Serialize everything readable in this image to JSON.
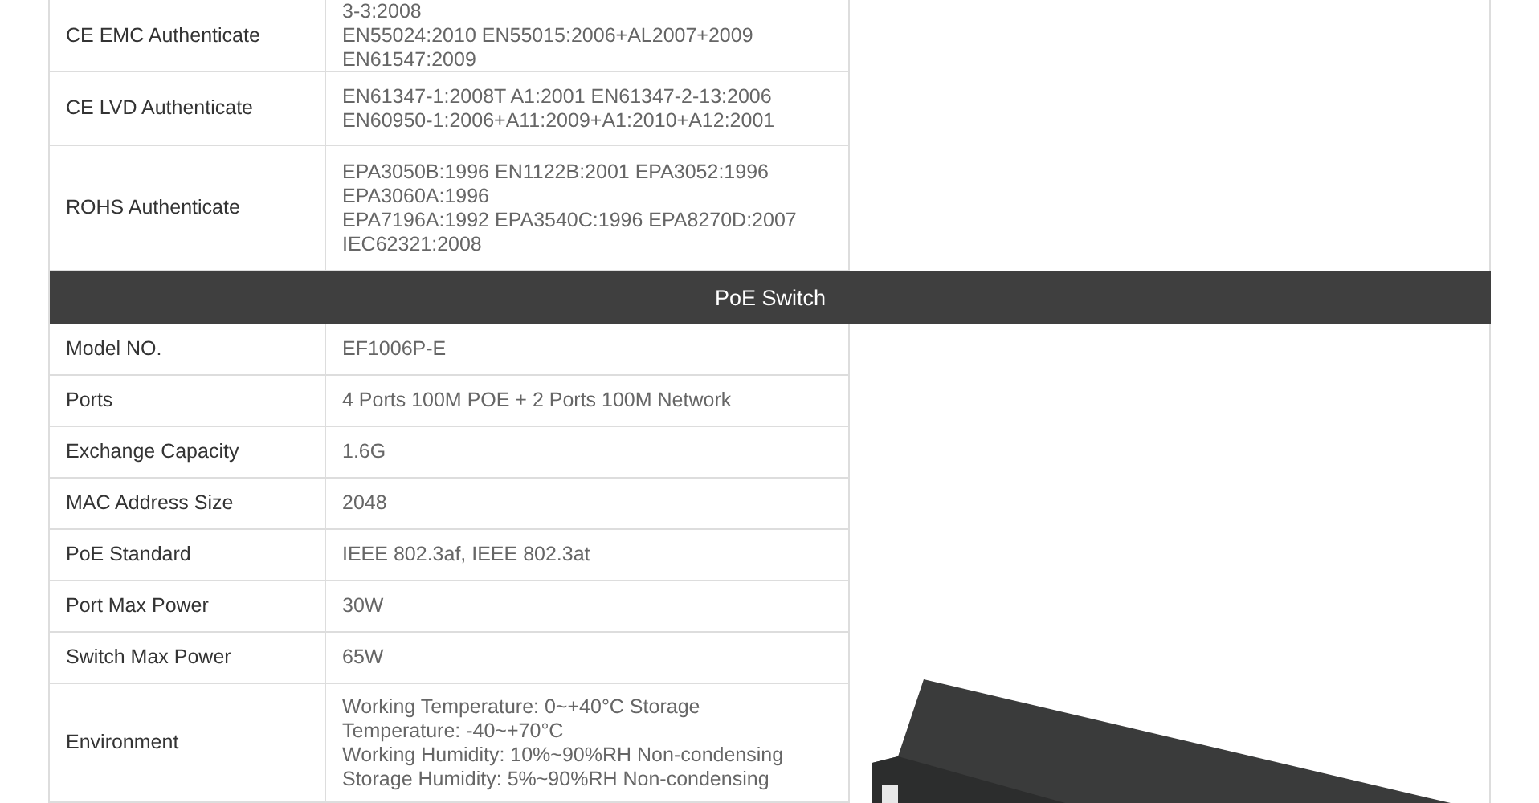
{
  "certifications": [
    {
      "label": "CE EMC Authenticate",
      "value": "3-3:2008\nEN55024:2010 EN55015:2006+AL2007+2009\nEN61547:2009"
    },
    {
      "label": "CE LVD Authenticate",
      "value": "EN61347-1:2008T A1:2001 EN61347-2-13:2006\nEN60950-1:2006+A11:2009+A1:2010+A12:2001"
    },
    {
      "label": "ROHS Authenticate",
      "value": "EPA3050B:1996 EN1122B:2001 EPA3052:1996\nEPA3060A:1996\nEPA7196A:1992 EPA3540C:1996 EPA8270D:2007\nIEC62321:2008"
    }
  ],
  "section_header": "PoE Switch",
  "specs": [
    {
      "label": "Model NO.",
      "value": "EF1006P-E"
    },
    {
      "label": "Ports",
      "value": "4 Ports 100M POE + 2 Ports 100M Network"
    },
    {
      "label": "Exchange Capacity",
      "value": "1.6G"
    },
    {
      "label": "MAC Address Size",
      "value": "2048"
    },
    {
      "label": "PoE Standard",
      "value": "IEEE 802.3af, IEEE 802.3at"
    },
    {
      "label": "Port Max Power",
      "value": "30W"
    },
    {
      "label": "Switch Max Power",
      "value": "65W"
    },
    {
      "label": "Environment",
      "value": "Working Temperature: 0~+40°C Storage\nTemperature: -40~+70°C\nWorking Humidity: 10%~90%RH Non-condensing\nStorage Humidity: 5%~90%RH Non-condensing"
    }
  ]
}
